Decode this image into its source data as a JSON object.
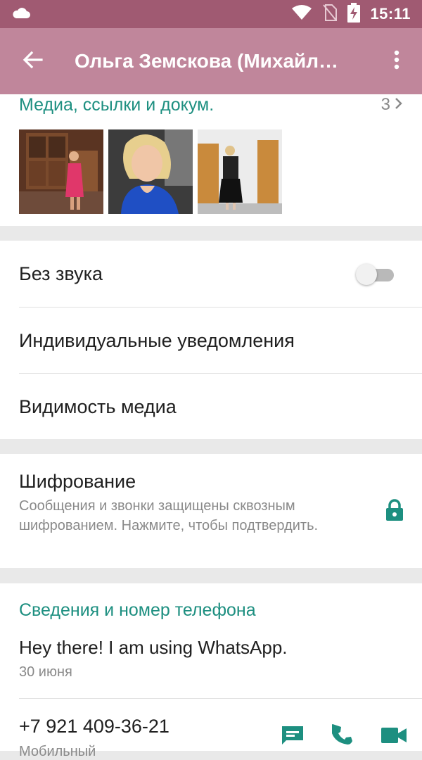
{
  "status_bar": {
    "time": "15:11",
    "icons": [
      "cloud-icon",
      "wifi-icon",
      "no-sim-icon",
      "battery-charging-icon"
    ]
  },
  "app_bar": {
    "title": "Ольга Земскова (Михайл…",
    "back_icon": "arrow-back-icon",
    "menu_icon": "more-vert-icon"
  },
  "media": {
    "title": "Медиа, ссылки и докум.",
    "count": "3",
    "thumbnails": [
      "photo-woman-pink-dress",
      "photo-woman-blue-top",
      "photo-woman-black-dress"
    ]
  },
  "settings": {
    "mute_label": "Без звука",
    "mute_enabled": false,
    "custom_notifications_label": "Индивидуальные уведомления",
    "media_visibility_label": "Видимость медиа"
  },
  "encryption": {
    "title": "Шифрование",
    "description": "Сообщения и звонки защищены сквозным шифрованием. Нажмите, чтобы подтвердить.",
    "icon": "lock-icon"
  },
  "info": {
    "header": "Сведения и номер телефона",
    "about": "Hey there! I am using WhatsApp.",
    "about_date": "30 июня",
    "phone": "+7 921 409-36-21",
    "phone_type": "Мобильный",
    "actions": [
      "message-icon",
      "call-icon",
      "video-call-icon"
    ]
  },
  "colors": {
    "status_bar": "#a05a72",
    "app_bar": "#c0869b",
    "accent": "#1d8f80",
    "background": "#e9e9e9"
  }
}
